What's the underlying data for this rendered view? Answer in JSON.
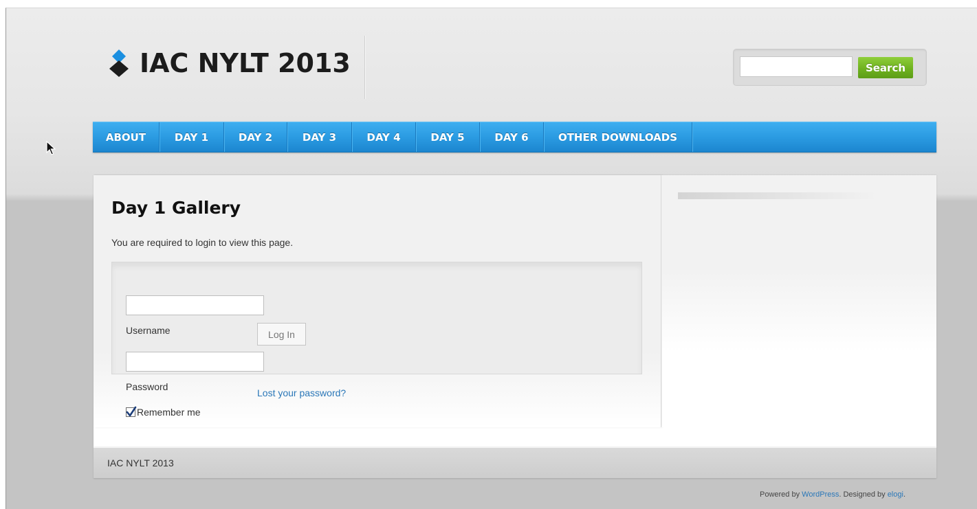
{
  "header": {
    "site_title": "IAC NYLT 2013",
    "logo_icon": "diamond-logo-icon"
  },
  "search": {
    "value": "",
    "placeholder": "",
    "button_label": "Search"
  },
  "nav": {
    "items": [
      {
        "label": "ABOUT"
      },
      {
        "label": "DAY 1"
      },
      {
        "label": "DAY 2"
      },
      {
        "label": "DAY 3"
      },
      {
        "label": "DAY 4"
      },
      {
        "label": "DAY 5"
      },
      {
        "label": "DAY 6"
      },
      {
        "label": "OTHER DOWNLOADS"
      }
    ]
  },
  "main": {
    "title": "Day 1 Gallery",
    "login_note": "You are required to login to view this page.",
    "username_value": "",
    "username_label": "Username",
    "password_value": "",
    "password_label": "Password",
    "login_button": "Log In",
    "lost_password": "Lost your password?",
    "remember_label": "Remember me",
    "remember_checked": true
  },
  "footer": {
    "text": "IAC NYLT 2013"
  },
  "credits": {
    "prefix": "Powered by ",
    "wordpress": "WordPress",
    "middle": ". Designed by ",
    "designer": "elogi",
    "suffix": "."
  },
  "colors": {
    "nav_blue": "#2b9be2",
    "search_green": "#6fb21f",
    "link_blue": "#2a77b8"
  }
}
